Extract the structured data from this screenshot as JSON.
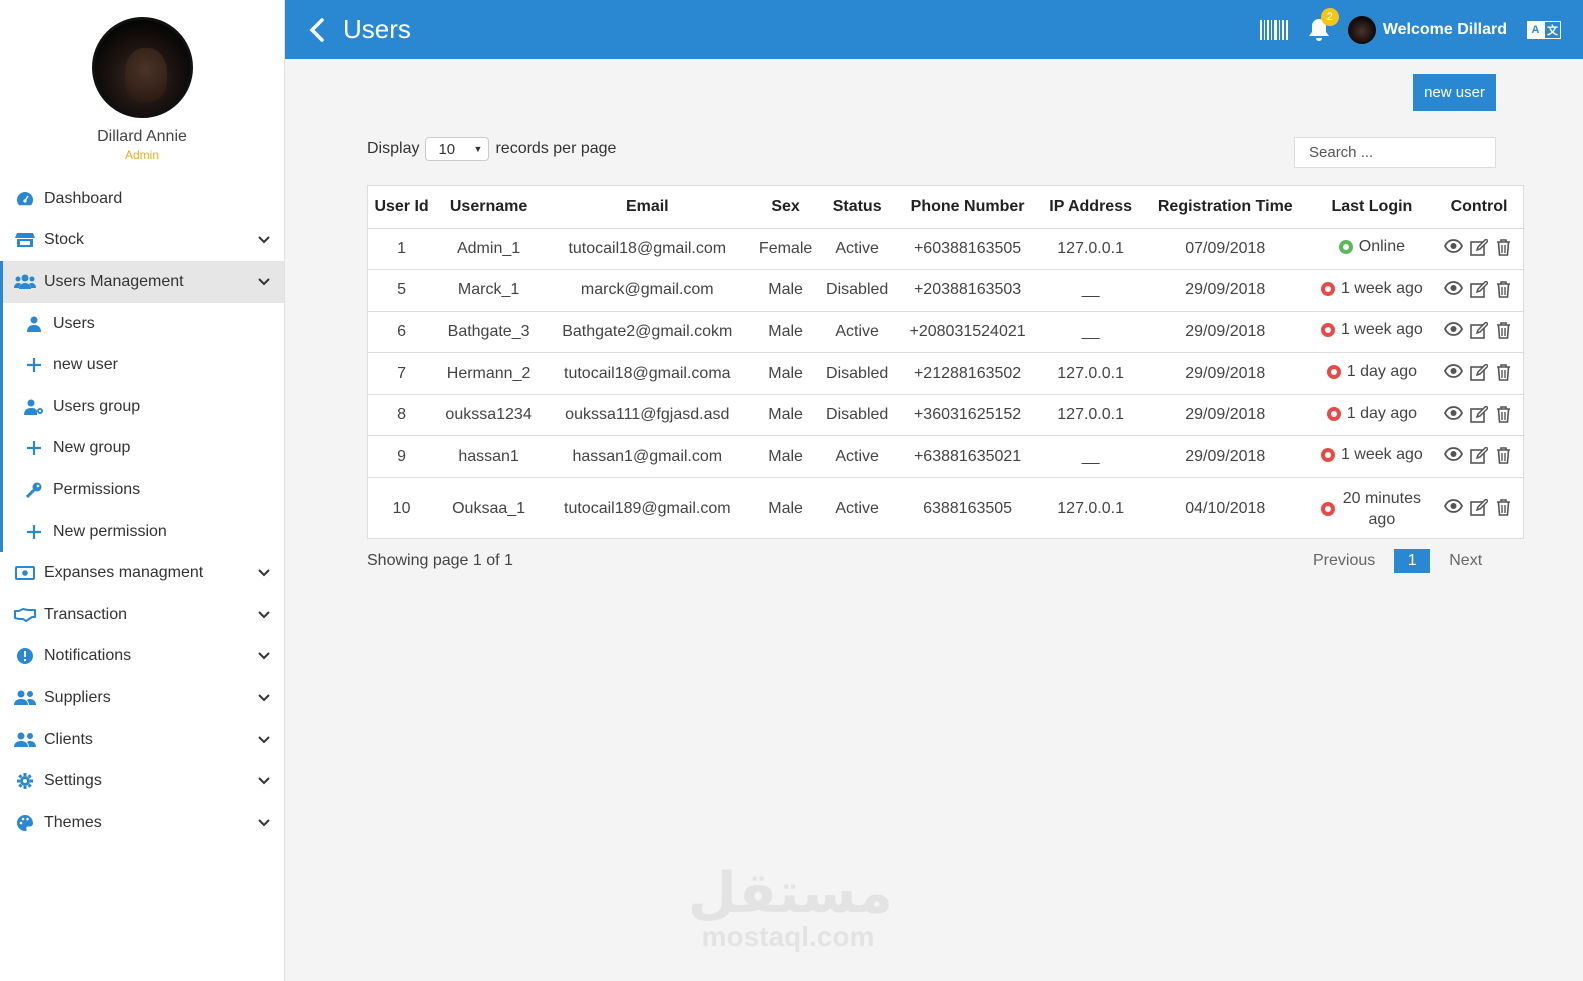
{
  "profile": {
    "name": "Dillard Annie",
    "role": "Admin"
  },
  "sidebar": {
    "items": [
      {
        "label": "Dashboard",
        "icon": "dashboard-icon",
        "expandable": false
      },
      {
        "label": "Stock",
        "icon": "store-icon",
        "expandable": true
      },
      {
        "label": "Users Management",
        "icon": "users-icon",
        "expandable": true,
        "active": true
      },
      {
        "label": "Expanses managment",
        "icon": "money-icon",
        "expandable": true
      },
      {
        "label": "Transaction",
        "icon": "handshake-icon",
        "expandable": true
      },
      {
        "label": "Notifications",
        "icon": "alert-circle-icon",
        "expandable": true
      },
      {
        "label": "Suppliers",
        "icon": "users-icon",
        "expandable": true
      },
      {
        "label": "Clients",
        "icon": "users-icon",
        "expandable": true
      },
      {
        "label": "Settings",
        "icon": "gear-icon",
        "expandable": true
      },
      {
        "label": "Themes",
        "icon": "palette-icon",
        "expandable": true
      }
    ],
    "sub_items": [
      {
        "label": "Users",
        "icon": "user-icon"
      },
      {
        "label": "new user",
        "icon": "plus-icon"
      },
      {
        "label": "Users group",
        "icon": "user-cog-icon"
      },
      {
        "label": "New group",
        "icon": "plus-icon"
      },
      {
        "label": "Permissions",
        "icon": "key-icon"
      },
      {
        "label": "New permission",
        "icon": "plus-icon"
      }
    ]
  },
  "header": {
    "title": "Users",
    "notification_count": "2",
    "welcome": "Welcome Dillard",
    "lang_left": "A",
    "lang_right": "文"
  },
  "toolbar": {
    "new_user_label": "new user",
    "display_prefix": "Display",
    "display_value": "10",
    "display_suffix": "records per page",
    "search_placeholder": "Search ..."
  },
  "table": {
    "columns": [
      "User Id",
      "Username",
      "Email",
      "Sex",
      "Status",
      "Phone Number",
      "IP Address",
      "Registration Time",
      "Last Login",
      "Control"
    ],
    "rows": [
      {
        "id": "1",
        "username": "Admin_1",
        "email": "tutocail18@gmail.com",
        "sex": "Female",
        "status": "Active",
        "phone": "+60388163505",
        "ip": "127.0.0.1",
        "registered": "07/09/2018",
        "last_login": "Online",
        "online": true
      },
      {
        "id": "5",
        "username": "Marck_1",
        "email": "marck@gmail.com",
        "sex": "Male",
        "status": "Disabled",
        "phone": "+20388163503",
        "ip": "__",
        "registered": "29/09/2018",
        "last_login": "1 week ago",
        "online": false
      },
      {
        "id": "6",
        "username": "Bathgate_3",
        "email": "Bathgate2@gmail.cokm",
        "sex": "Male",
        "status": "Active",
        "phone": "+208031524021",
        "ip": "__",
        "registered": "29/09/2018",
        "last_login": "1 week ago",
        "online": false
      },
      {
        "id": "7",
        "username": "Hermann_2",
        "email": "tutocail18@gmail.coma",
        "sex": "Male",
        "status": "Disabled",
        "phone": "+21288163502",
        "ip": "127.0.0.1",
        "registered": "29/09/2018",
        "last_login": "1 day ago",
        "online": false
      },
      {
        "id": "8",
        "username": "oukssa1234",
        "email": "oukssa111@fgjasd.asd",
        "sex": "Male",
        "status": "Disabled",
        "phone": "+36031625152",
        "ip": "127.0.0.1",
        "registered": "29/09/2018",
        "last_login": "1 day ago",
        "online": false
      },
      {
        "id": "9",
        "username": "hassan1",
        "email": "hassan1@gmail.com",
        "sex": "Male",
        "status": "Active",
        "phone": "+63881635021",
        "ip": "__",
        "registered": "29/09/2018",
        "last_login": "1 week ago",
        "online": false
      },
      {
        "id": "10",
        "username": "Ouksaa_1",
        "email": "tutocail189@gmail.com",
        "sex": "Male",
        "status": "Active",
        "phone": "6388163505",
        "ip": "127.0.0.1",
        "registered": "04/10/2018",
        "last_login": "20 minutes ago",
        "online": false
      }
    ]
  },
  "pagination": {
    "showing": "Showing page 1 of 1",
    "previous": "Previous",
    "current": "1",
    "next": "Next"
  },
  "watermark": {
    "arabic": "مستقل",
    "latin": "mostaql.com"
  },
  "colors": {
    "primary": "#2a88d2",
    "online": "#5cb85c",
    "offline": "#e84a4a",
    "badge": "#f5c518",
    "role": "#e0b01c"
  }
}
